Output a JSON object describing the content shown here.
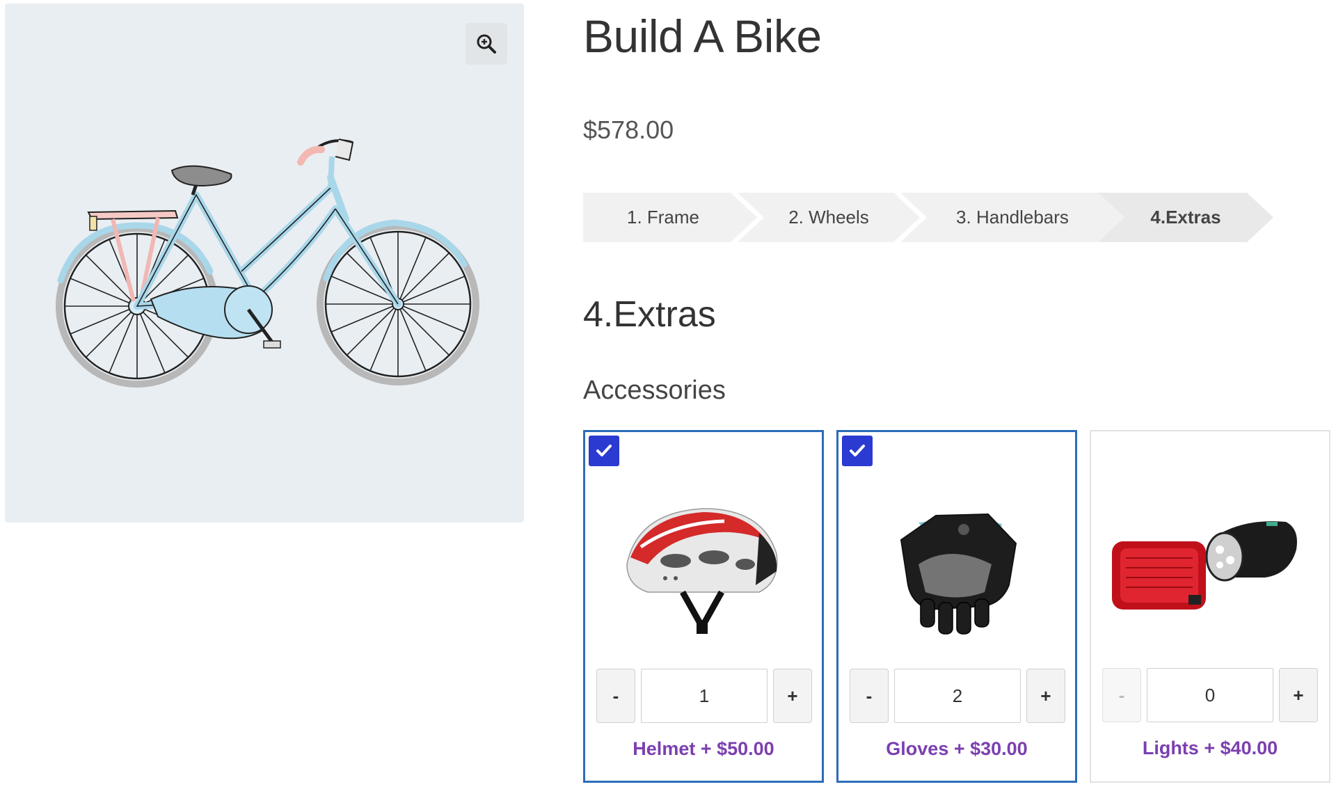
{
  "product": {
    "title": "Build A Bike",
    "price": "$578.00"
  },
  "gallery": {
    "zoom_icon": "zoom-in-icon",
    "image": "bicycle-illustration"
  },
  "steps": [
    {
      "label": "1. Frame",
      "active": false
    },
    {
      "label": "2. Wheels",
      "active": false
    },
    {
      "label": "3. Handlebars",
      "active": false
    },
    {
      "label": "4.Extras",
      "active": true
    }
  ],
  "current_step": {
    "heading": "4.Extras",
    "group_title": "Accessories"
  },
  "accessories": [
    {
      "name": "Helmet",
      "label": "Helmet + $50.00",
      "quantity": "1",
      "selected": true,
      "minus": "-",
      "plus": "+"
    },
    {
      "name": "Gloves",
      "label": "Gloves + $30.00",
      "quantity": "2",
      "selected": true,
      "minus": "-",
      "plus": "+"
    },
    {
      "name": "Lights",
      "label": "Lights + $40.00",
      "quantity": "0",
      "selected": false,
      "minus": "-",
      "plus": "+"
    }
  ],
  "colors": {
    "selected_border": "#2a6db8",
    "checkbox": "#2b3ad1",
    "label": "#7b3fb0",
    "gallery_bg": "#e9eef2"
  }
}
